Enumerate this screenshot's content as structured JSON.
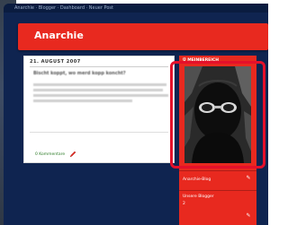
{
  "window": {
    "topbar_text": "Anarchie · Blogger · Dashboard · Neuer Post"
  },
  "header": {
    "title": "Anarchie"
  },
  "post": {
    "date": "21. AUGUST 2007",
    "title": "Bischt koppt, wo merd kopp koncht?",
    "comments_label": "0 Kommentare",
    "edit_icon": "pencil-icon"
  },
  "sidebar": {
    "heading": "Ü MEINBEREICH",
    "profile_photo_description_icon": "avatar",
    "items": [
      {
        "label": "Anarchie-Blog",
        "icon": "wrench-icon"
      },
      {
        "label": "Unsere Blogger",
        "value": "2",
        "icon": "wrench-icon"
      }
    ]
  },
  "colors": {
    "accent": "#e8291f",
    "background": "#0f2450",
    "highlight": "#e4102a",
    "card": "#ffffff",
    "link_green": "#2f7d2a"
  }
}
